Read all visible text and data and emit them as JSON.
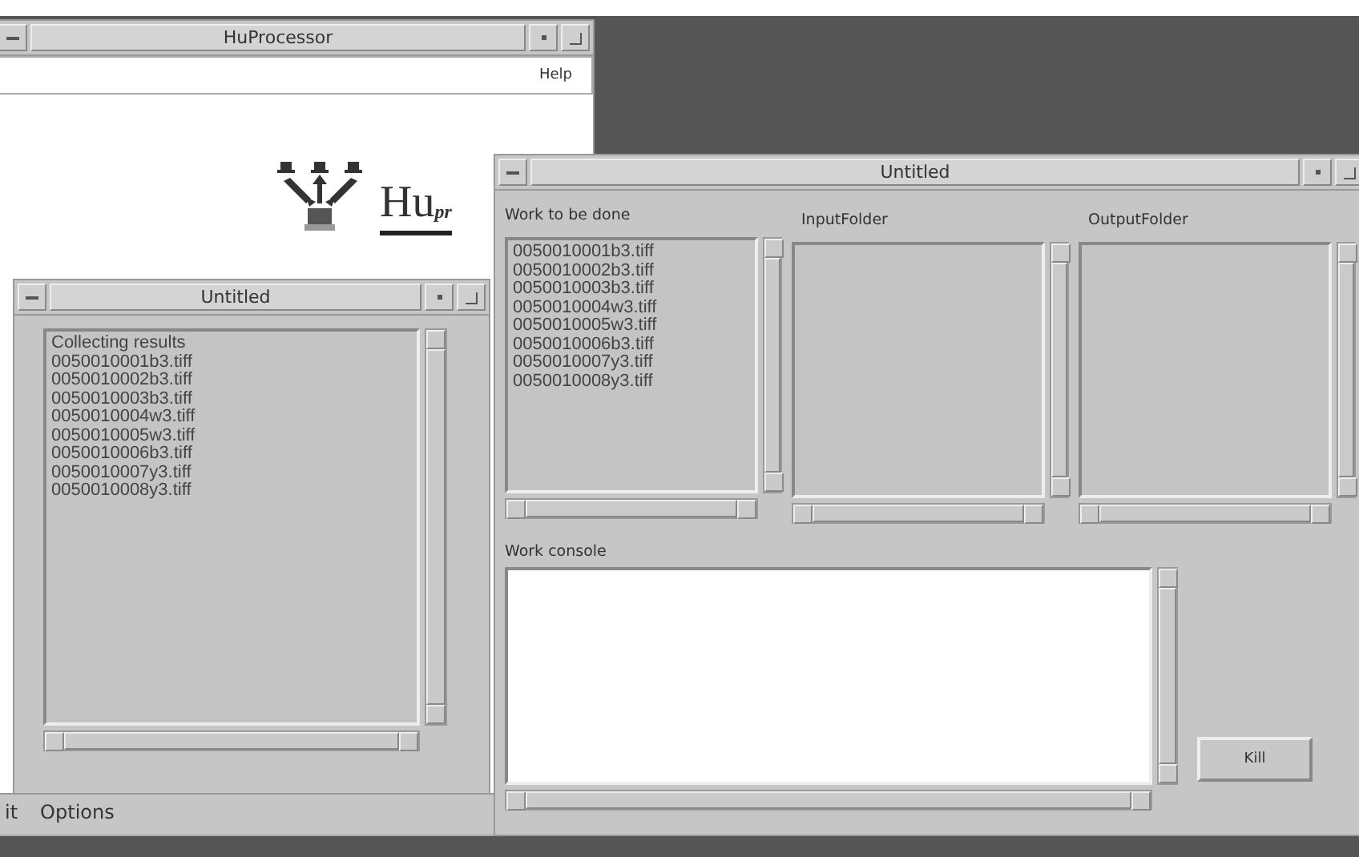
{
  "main_window": {
    "title": "HuProcessor",
    "menu": [
      {
        "label": "Help"
      }
    ],
    "logo": {
      "text": "Hu",
      "subtext": "pr"
    }
  },
  "back_window": {
    "menu": [
      {
        "label": "it"
      },
      {
        "label": "Options"
      }
    ]
  },
  "results_window": {
    "title": "Untitled",
    "lines": [
      "Collecting results",
      "0050010001b3.tiff",
      "0050010002b3.tiff",
      "0050010003b3.tiff",
      "0050010004w3.tiff",
      "0050010005w3.tiff",
      "0050010006b3.tiff",
      "0050010007y3.tiff",
      "0050010008y3.tiff"
    ]
  },
  "work_window": {
    "title": "Untitled",
    "lists": [
      {
        "label": "Work to be done",
        "items": [
          "0050010001b3.tiff",
          "0050010002b3.tiff",
          "0050010003b3.tiff",
          "0050010004w3.tiff",
          "0050010005w3.tiff",
          "0050010006b3.tiff",
          "0050010007y3.tiff",
          "0050010008y3.tiff"
        ]
      },
      {
        "label": "InputFolder"
      },
      {
        "label": "OutputFolder"
      }
    ],
    "console": {
      "label": "Work console"
    },
    "button": "Kill"
  }
}
